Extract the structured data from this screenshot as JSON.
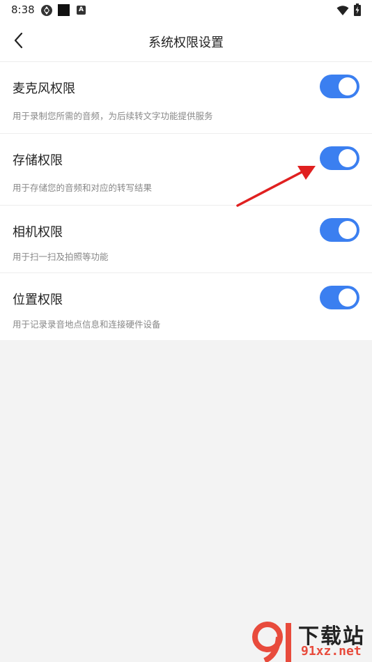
{
  "status_bar": {
    "time": "8:38",
    "icons": [
      "aperture-icon",
      "black-square-icon",
      "a-badge-icon",
      "wifi-icon",
      "battery-charging-icon"
    ],
    "a_badge": "A"
  },
  "header": {
    "back_icon": "chevron-left-icon",
    "title": "系统权限设置"
  },
  "permissions": [
    {
      "title": "麦克风权限",
      "description": "用于录制您所需的音频，为后续转文字功能提供服务",
      "enabled": true
    },
    {
      "title": "存储权限",
      "description": "用于存储您的音频和对应的转写结果",
      "enabled": true
    },
    {
      "title": "相机权限",
      "description": "用于扫一扫及拍照等功能",
      "enabled": true
    },
    {
      "title": "位置权限",
      "description": "用于记录录音地点信息和连接硬件设备",
      "enabled": true
    }
  ],
  "colors": {
    "toggle_on": "#3b7ff0",
    "background": "#f3f3f3",
    "annotation_arrow": "#e02020",
    "watermark_red": "#e84b3c"
  },
  "watermark": {
    "top_text": "下载站",
    "bottom_text": "91xz.net"
  }
}
